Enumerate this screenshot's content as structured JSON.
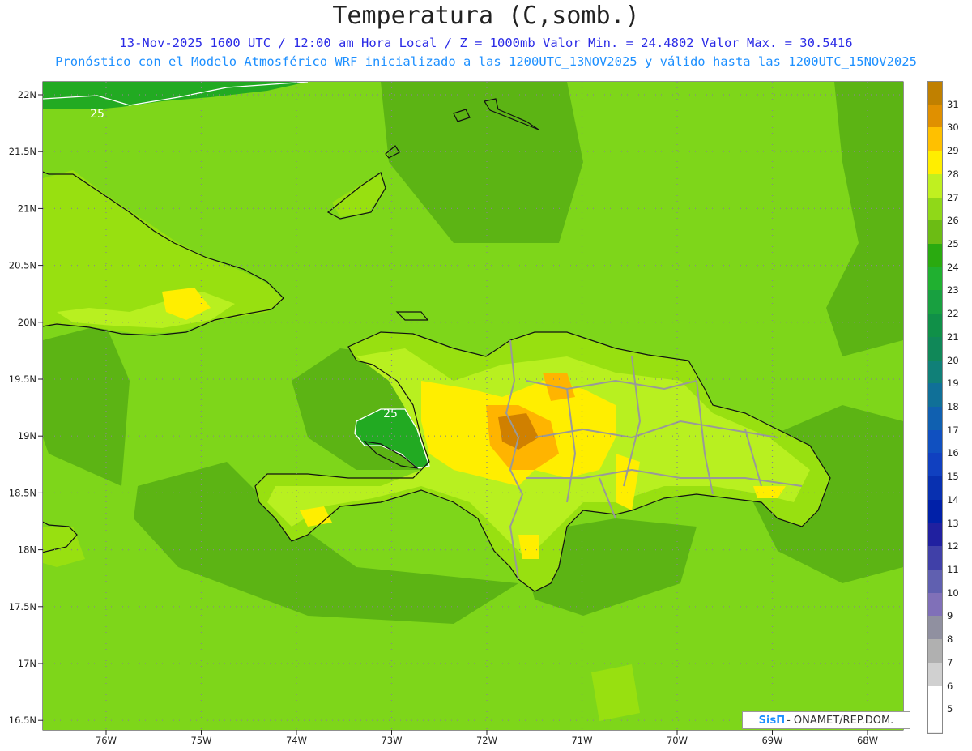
{
  "header": {
    "title": "Temperatura (C,somb.)",
    "line1": "13-Nov-2025 1600 UTC / 12:00 am Hora Local / Z = 1000mb  Valor Min. = 24.4802  Valor Max. = 30.5416",
    "line2": "Pronóstico con el Modelo Atmosférico WRF inicializado a las 1200UTC_13NOV2025 y válido hasta las  1200UTC_15NOV2025"
  },
  "map": {
    "lat_labels": [
      "22N",
      "21.5N",
      "21N",
      "20.5N",
      "20N",
      "19.5N",
      "19N",
      "18.5N",
      "18N",
      "17.5N",
      "17N",
      "16.5N"
    ],
    "lon_labels": [
      "76W",
      "75W",
      "74W",
      "73W",
      "72W",
      "71W",
      "70W",
      "69W",
      "68W"
    ],
    "contour_labels": [
      "25",
      "25"
    ],
    "colors": {
      "ocean": "#7ed61a",
      "ocean_dark": "#5cb414",
      "land": "#98e010",
      "land_light": "#b8f020",
      "warm_yellow": "#ffee00",
      "warm_orange": "#ffb400",
      "hot": "#d08000",
      "cool_green": "#22aa22",
      "coast": "#111111",
      "border": "#999999"
    }
  },
  "colorbar": {
    "labels": [
      "31",
      "30",
      "29",
      "28",
      "27",
      "26",
      "25",
      "24",
      "23",
      "22",
      "21",
      "20",
      "19",
      "18",
      "17",
      "16",
      "15",
      "14",
      "13",
      "12",
      "11",
      "10",
      "9",
      "8",
      "7",
      "6",
      "5"
    ],
    "colors": [
      "#c08000",
      "#e09000",
      "#ffc000",
      "#ffee00",
      "#c0f020",
      "#90d818",
      "#6cbc14",
      "#2aaa10",
      "#20b030",
      "#18a040",
      "#109048",
      "#108858",
      "#108078",
      "#107098",
      "#1060b0",
      "#1050c0",
      "#1040c0",
      "#0830b0",
      "#0020a8",
      "#2020a0",
      "#4040a8",
      "#6060b0",
      "#8070b8",
      "#9090a0",
      "#b0b0b0",
      "#d0d0d0",
      "#ffffff"
    ]
  },
  "credit": {
    "logo": "SisΠ",
    "text": " - ONAMET/REP.DOM."
  }
}
